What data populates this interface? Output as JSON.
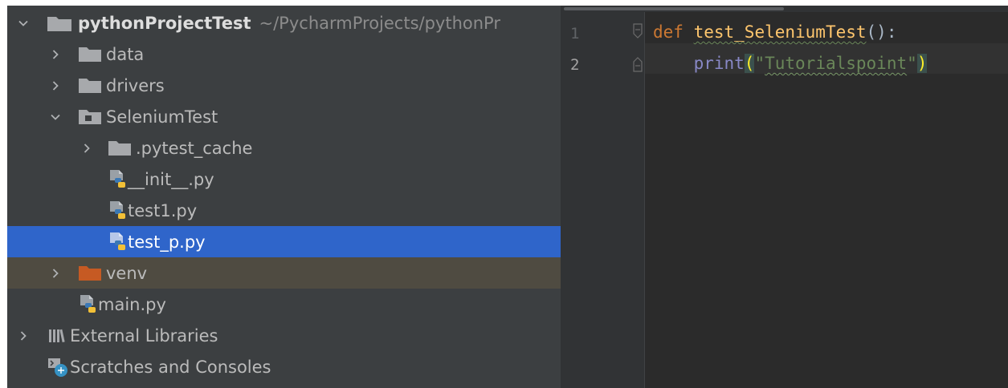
{
  "project_tree": {
    "root": {
      "name": "pythonProjectTest",
      "path": "~/PycharmProjects/pythonPr"
    },
    "items": [
      {
        "label": "data"
      },
      {
        "label": "drivers"
      },
      {
        "label": "SeleniumTest"
      },
      {
        "label": ".pytest_cache"
      },
      {
        "label": "__init__.py"
      },
      {
        "label": "test1.py"
      },
      {
        "label": "test_p.py"
      },
      {
        "label": "venv"
      },
      {
        "label": "main.py"
      },
      {
        "label": "External Libraries"
      },
      {
        "label": "Scratches and Consoles"
      }
    ]
  },
  "editor": {
    "line_numbers": [
      "1",
      "2"
    ],
    "line1": {
      "keyword": "def",
      "function": "test_SeleniumTest",
      "suffix": "():"
    },
    "line2": {
      "builtin": "print",
      "open": "(",
      "quote_open": "\"",
      "string": "Tutorialspoint",
      "quote_close": "\"",
      "close": ")"
    }
  },
  "colors": {
    "selection": "#2f65ca",
    "excluded_folder_row": "#4f4b41",
    "folder_icon": "#a7a9ac",
    "excluded_folder_icon": "#c65a23",
    "editor_background": "#2b2b2b"
  }
}
